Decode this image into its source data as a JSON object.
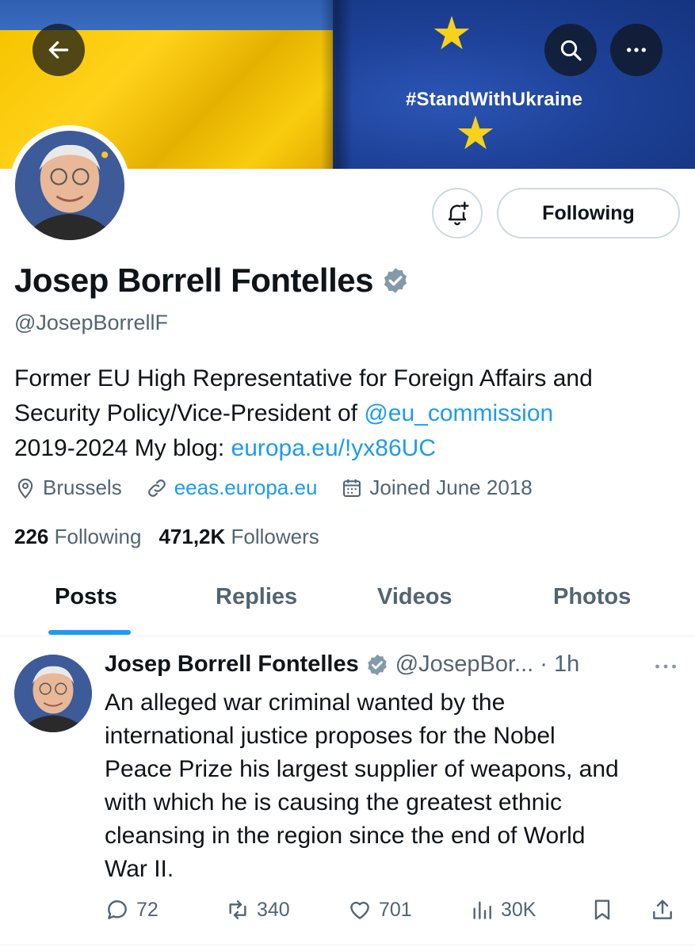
{
  "banner": {
    "hashtag": "#StandWithUkraine",
    "colors": {
      "ukraine_blue": "#3a6cc0",
      "ukraine_yellow": "#f6c400",
      "eu_blue": "#1e4299",
      "eu_star": "#f7d21b"
    }
  },
  "header_buttons": {
    "back_icon": "arrow-left-icon",
    "search_icon": "search-icon",
    "more_icon": "more-horizontal-icon"
  },
  "profile": {
    "display_name": "Josep Borrell Fontelles",
    "handle": "@JosepBorrellF",
    "verified_icon": "verified-badge-icon",
    "verified_color": "#829aab",
    "notify_icon": "bell-plus-icon",
    "follow_button_label": "Following",
    "bio": {
      "line1": "Former EU High Representative for Foreign Affairs and",
      "line2_prefix": "Security Policy/Vice-President of ",
      "line2_mention": "@eu_commission",
      "line3_prefix": "2019-2024 My blog: ",
      "line3_link": "europa.eu/!yx86UC"
    },
    "location": "Brussels",
    "website": "eeas.europa.eu",
    "joined": "Joined June 2018",
    "following_count": "226",
    "following_label": "Following",
    "followers_count": "471,2K",
    "followers_label": "Followers"
  },
  "tabs": [
    {
      "label": "Posts",
      "active": true
    },
    {
      "label": "Replies",
      "active": false
    },
    {
      "label": "Videos",
      "active": false
    },
    {
      "label": "Photos",
      "active": false
    }
  ],
  "post": {
    "author": "Josep Borrell Fontelles",
    "handle_time": "@JosepBor... · 1h",
    "lines": [
      "An alleged war criminal wanted by the",
      "international justice proposes for the Nobel",
      "Peace Prize his largest supplier of weapons, and",
      "with which he is causing the greatest ethnic",
      "cleansing in the region since the end of World",
      "War II."
    ],
    "replies": "72",
    "reposts": "340",
    "likes": "701",
    "views": "30K"
  },
  "accent_color": "#1d9bf0"
}
